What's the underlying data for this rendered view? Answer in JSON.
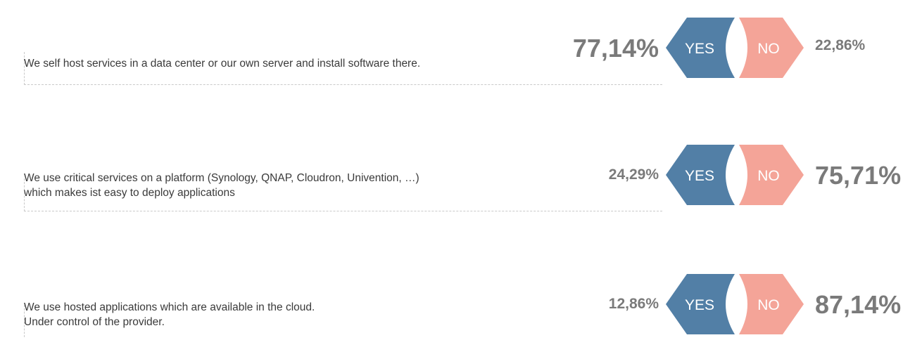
{
  "colors": {
    "yes": "#527fa6",
    "no": "#f4a498",
    "percent_text": "#7a7a7a",
    "question_text": "#3a3a3a"
  },
  "chart_data": {
    "type": "bar",
    "series": [
      {
        "name": "YES"
      },
      {
        "name": "NO"
      }
    ],
    "items": [
      {
        "question_lines": [
          "We self host services in a data center or our own server and install software there."
        ],
        "yes_label": "YES",
        "no_label": "NO",
        "yes_pct": 77.14,
        "no_pct": 22.86,
        "yes_text": "77,14%",
        "no_text": "22,86%"
      },
      {
        "question_lines": [
          "We use critical services on a platform (Synology, QNAP, Cloudron, Univention, …)",
          "which makes ist easy to deploy applications"
        ],
        "yes_label": "YES",
        "no_label": "NO",
        "yes_pct": 24.29,
        "no_pct": 75.71,
        "yes_text": "24,29%",
        "no_text": "75,71%"
      },
      {
        "question_lines": [
          "We use hosted applications which are available in the cloud.",
          "Under control of the provider."
        ],
        "yes_label": "YES",
        "no_label": "NO",
        "yes_pct": 12.86,
        "no_pct": 87.14,
        "yes_text": "12,86%",
        "no_text": "87,14%"
      }
    ]
  }
}
